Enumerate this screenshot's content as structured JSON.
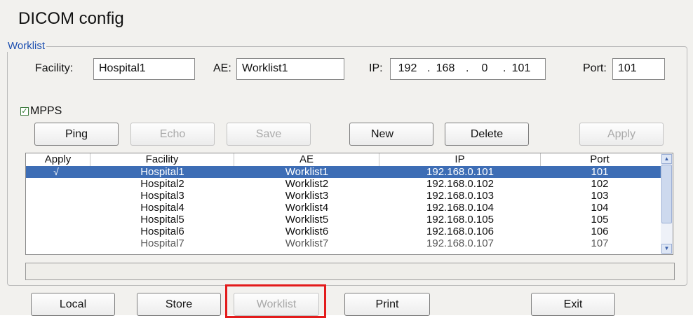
{
  "window": {
    "title": "DICOM config"
  },
  "group": {
    "label": "Worklist"
  },
  "form": {
    "facility_label": "Facility:",
    "facility_value": "Hospital1",
    "ae_label": "AE:",
    "ae_value": "Worklist1",
    "ip_label": "IP:",
    "ip_octets": [
      "192",
      "168",
      "0",
      "101"
    ],
    "port_label": "Port:",
    "port_value": "101",
    "mpps_label": "MPPS",
    "mpps_checked": true
  },
  "toolbar": {
    "ping": "Ping",
    "echo": "Echo",
    "save": "Save",
    "new": "New",
    "delete": "Delete",
    "apply": "Apply"
  },
  "table": {
    "columns": [
      "Apply",
      "Facility",
      "AE",
      "IP",
      "Port"
    ],
    "rows": [
      {
        "apply": "√",
        "facility": "Hospital1",
        "ae": "Worklist1",
        "ip": "192.168.0.101",
        "port": "101",
        "selected": true
      },
      {
        "apply": "",
        "facility": "Hospital2",
        "ae": "Worklist2",
        "ip": "192.168.0.102",
        "port": "102"
      },
      {
        "apply": "",
        "facility": "Hospital3",
        "ae": "Worklist3",
        "ip": "192.168.0.103",
        "port": "103"
      },
      {
        "apply": "",
        "facility": "Hospital4",
        "ae": "Worklist4",
        "ip": "192.168.0.104",
        "port": "104"
      },
      {
        "apply": "",
        "facility": "Hospital5",
        "ae": "Worklist5",
        "ip": "192.168.0.105",
        "port": "105"
      },
      {
        "apply": "",
        "facility": "Hospital6",
        "ae": "Worklist6",
        "ip": "192.168.0.106",
        "port": "106"
      },
      {
        "apply": "",
        "facility": "Hospital7",
        "ae": "Worklist7",
        "ip": "192.168.0.107",
        "port": "107"
      }
    ]
  },
  "bottom_nav": {
    "local": "Local",
    "store": "Store",
    "worklist": "Worklist",
    "print": "Print",
    "exit": "Exit"
  },
  "colors": {
    "selected_row": "#3d6db5",
    "group_label": "#1d4fb0",
    "highlight": "#e31b1b"
  }
}
